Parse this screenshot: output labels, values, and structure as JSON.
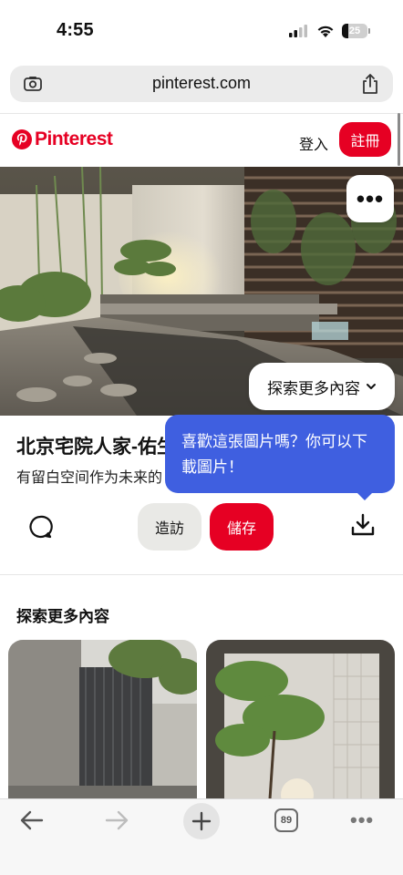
{
  "status_bar": {
    "time": "4:55",
    "battery_level": "25",
    "icons": [
      "signal-icon",
      "wifi-icon",
      "battery-icon"
    ]
  },
  "browser": {
    "url": "pinterest.com",
    "icons": [
      "page-settings-icon",
      "share-icon"
    ]
  },
  "header": {
    "logo_text": "Pinterest",
    "login_label": "登入",
    "signup_label": "註冊"
  },
  "pin": {
    "more_label": "•••",
    "explore_more_label": "探索更多內容",
    "title": "北京宅院人家-佑生",
    "description": "有留白空间作为未来的",
    "visit_label": "造訪",
    "save_label": "儲存"
  },
  "tooltip": {
    "text": "喜歡這張圖片嗎？你可以下載圖片！"
  },
  "related": {
    "section_title": "探索更多內容"
  },
  "toolbar": {
    "tabs_count": "89",
    "more_label": "•••"
  },
  "colors": {
    "brand_red": "#e60023",
    "tooltip_blue": "#3f5fe0"
  }
}
